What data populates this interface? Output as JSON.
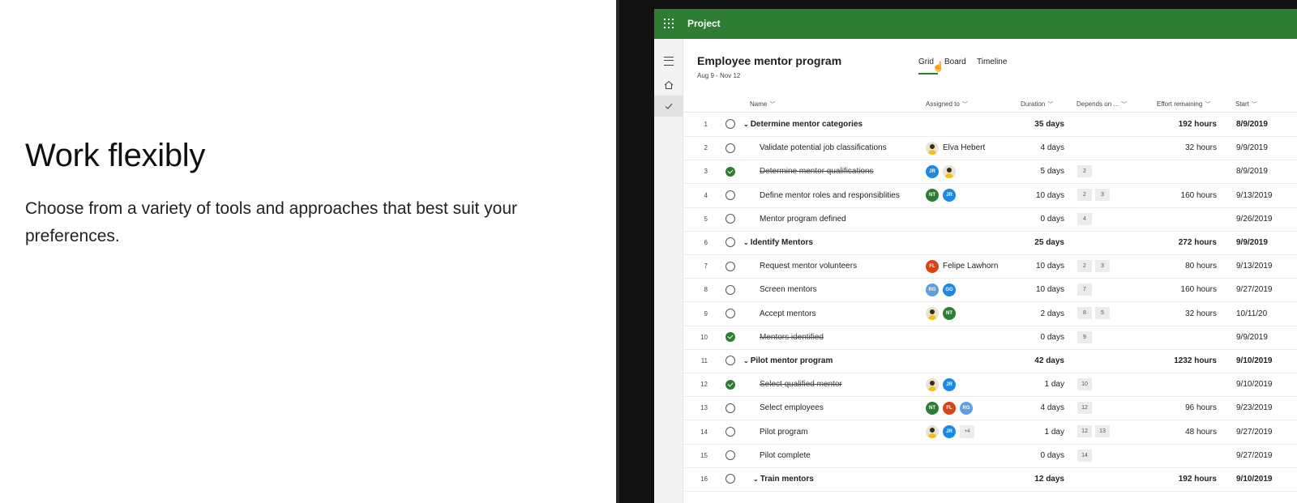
{
  "hero": {
    "heading": "Work flexibly",
    "body": "Choose from a variety of tools and approaches that best suit your preferences."
  },
  "app": {
    "name": "Project",
    "brand_color": "#2e7d32"
  },
  "project": {
    "title": "Employee mentor program",
    "dates": "Aug 9 - Nov 12"
  },
  "views": [
    "Grid",
    "Board",
    "Timeline"
  ],
  "selected_view": "Grid",
  "columns": {
    "name": "Name",
    "assigned": "Assigned to",
    "duration": "Duration",
    "depends": "Depends on ...",
    "effort": "Effort remaining",
    "start": "Start"
  },
  "rows": [
    {
      "num": "1",
      "name": "Determine mentor categories",
      "group": true,
      "done": false,
      "assigned": [],
      "duration": "35 days",
      "depends": [],
      "effort": "192 hours",
      "start": "8/9/2019"
    },
    {
      "num": "2",
      "name": "Validate potential job classifications",
      "group": false,
      "done": false,
      "assigned": [
        {
          "type": "photo"
        }
      ],
      "person": "Elva Hebert",
      "duration": "4 days",
      "depends": [],
      "effort": "32 hours",
      "start": "9/9/2019"
    },
    {
      "num": "3",
      "name": "Determine mentor qualifications",
      "group": false,
      "done": true,
      "assigned": [
        {
          "initials": "JR",
          "color": "#1e88e5"
        },
        {
          "type": "photo"
        }
      ],
      "duration": "5 days",
      "depends": [
        "2"
      ],
      "effort": "",
      "start": "8/9/2019"
    },
    {
      "num": "4",
      "name": "Define mentor roles and responsiblities",
      "group": false,
      "done": false,
      "assigned": [
        {
          "initials": "NT",
          "color": "#2e7d32"
        },
        {
          "initials": "JR",
          "color": "#1e88e5"
        }
      ],
      "duration": "10 days",
      "depends": [
        "2",
        "3"
      ],
      "effort": "160 hours",
      "start": "9/13/2019"
    },
    {
      "num": "5",
      "name": "Mentor program defined",
      "group": false,
      "done": false,
      "assigned": [],
      "duration": "0 days",
      "depends": [
        "4"
      ],
      "effort": "",
      "start": "9/26/2019"
    },
    {
      "num": "6",
      "name": "Identify Mentors",
      "group": true,
      "done": false,
      "assigned": [],
      "duration": "25 days",
      "depends": [],
      "effort": "272 hours",
      "start": "9/9/2019"
    },
    {
      "num": "7",
      "name": "Request mentor volunteers",
      "group": false,
      "done": false,
      "assigned": [
        {
          "initials": "FL",
          "color": "#d84315"
        }
      ],
      "person": "Felipe Lawhorn",
      "duration": "10 days",
      "depends": [
        "2",
        "3"
      ],
      "effort": "80 hours",
      "start": "9/13/2019"
    },
    {
      "num": "8",
      "name": "Screen mentors",
      "group": false,
      "done": false,
      "assigned": [
        {
          "initials": "RG",
          "color": "#5c9ee0"
        },
        {
          "initials": "GG",
          "color": "#1e88e5"
        }
      ],
      "duration": "10 days",
      "depends": [
        "7"
      ],
      "effort": "160 hours",
      "start": "9/27/2019"
    },
    {
      "num": "9",
      "name": "Accept mentors",
      "group": false,
      "done": false,
      "assigned": [
        {
          "type": "photo"
        },
        {
          "initials": "NT",
          "color": "#2e7d32"
        }
      ],
      "duration": "2 days",
      "depends": [
        "8",
        "5"
      ],
      "effort": "32 hours",
      "start": "10/11/20"
    },
    {
      "num": "10",
      "name": "Mentors identified",
      "group": false,
      "done": true,
      "assigned": [],
      "duration": "0 days",
      "depends": [
        "9"
      ],
      "effort": "",
      "start": "9/9/2019"
    },
    {
      "num": "11",
      "name": "Pilot mentor program",
      "group": true,
      "done": false,
      "assigned": [],
      "duration": "42 days",
      "depends": [],
      "effort": "1232 hours",
      "start": "9/10/2019"
    },
    {
      "num": "12",
      "name": "Select qualified mentor",
      "group": false,
      "done": true,
      "assigned": [
        {
          "type": "photo"
        },
        {
          "initials": "JR",
          "color": "#1e88e5"
        }
      ],
      "duration": "1 day",
      "depends": [
        "10"
      ],
      "effort": "",
      "start": "9/10/2019"
    },
    {
      "num": "13",
      "name": "Select employees",
      "group": false,
      "done": false,
      "assigned": [
        {
          "initials": "NT",
          "color": "#2e7d32"
        },
        {
          "initials": "FL",
          "color": "#d84315"
        },
        {
          "initials": "RG",
          "color": "#5c9ee0"
        }
      ],
      "duration": "4 days",
      "depends": [
        "12"
      ],
      "effort": "96 hours",
      "start": "9/23/2019"
    },
    {
      "num": "14",
      "name": "Pilot program",
      "group": false,
      "done": false,
      "assigned": [
        {
          "type": "photo"
        },
        {
          "initials": "JR",
          "color": "#1e88e5"
        },
        {
          "type": "more",
          "label": "+4"
        }
      ],
      "duration": "1 day",
      "depends": [
        "12",
        "13"
      ],
      "effort": "48 hours",
      "start": "9/27/2019"
    },
    {
      "num": "15",
      "name": "Pilot complete",
      "group": false,
      "done": false,
      "assigned": [],
      "duration": "0 days",
      "depends": [
        "14"
      ],
      "effort": "",
      "start": "9/27/2019"
    },
    {
      "num": "16",
      "name": "Train mentors",
      "group": true,
      "subgroup": true,
      "done": false,
      "assigned": [],
      "duration": "12 days",
      "depends": [],
      "effort": "192 hours",
      "start": "9/10/2019"
    }
  ]
}
